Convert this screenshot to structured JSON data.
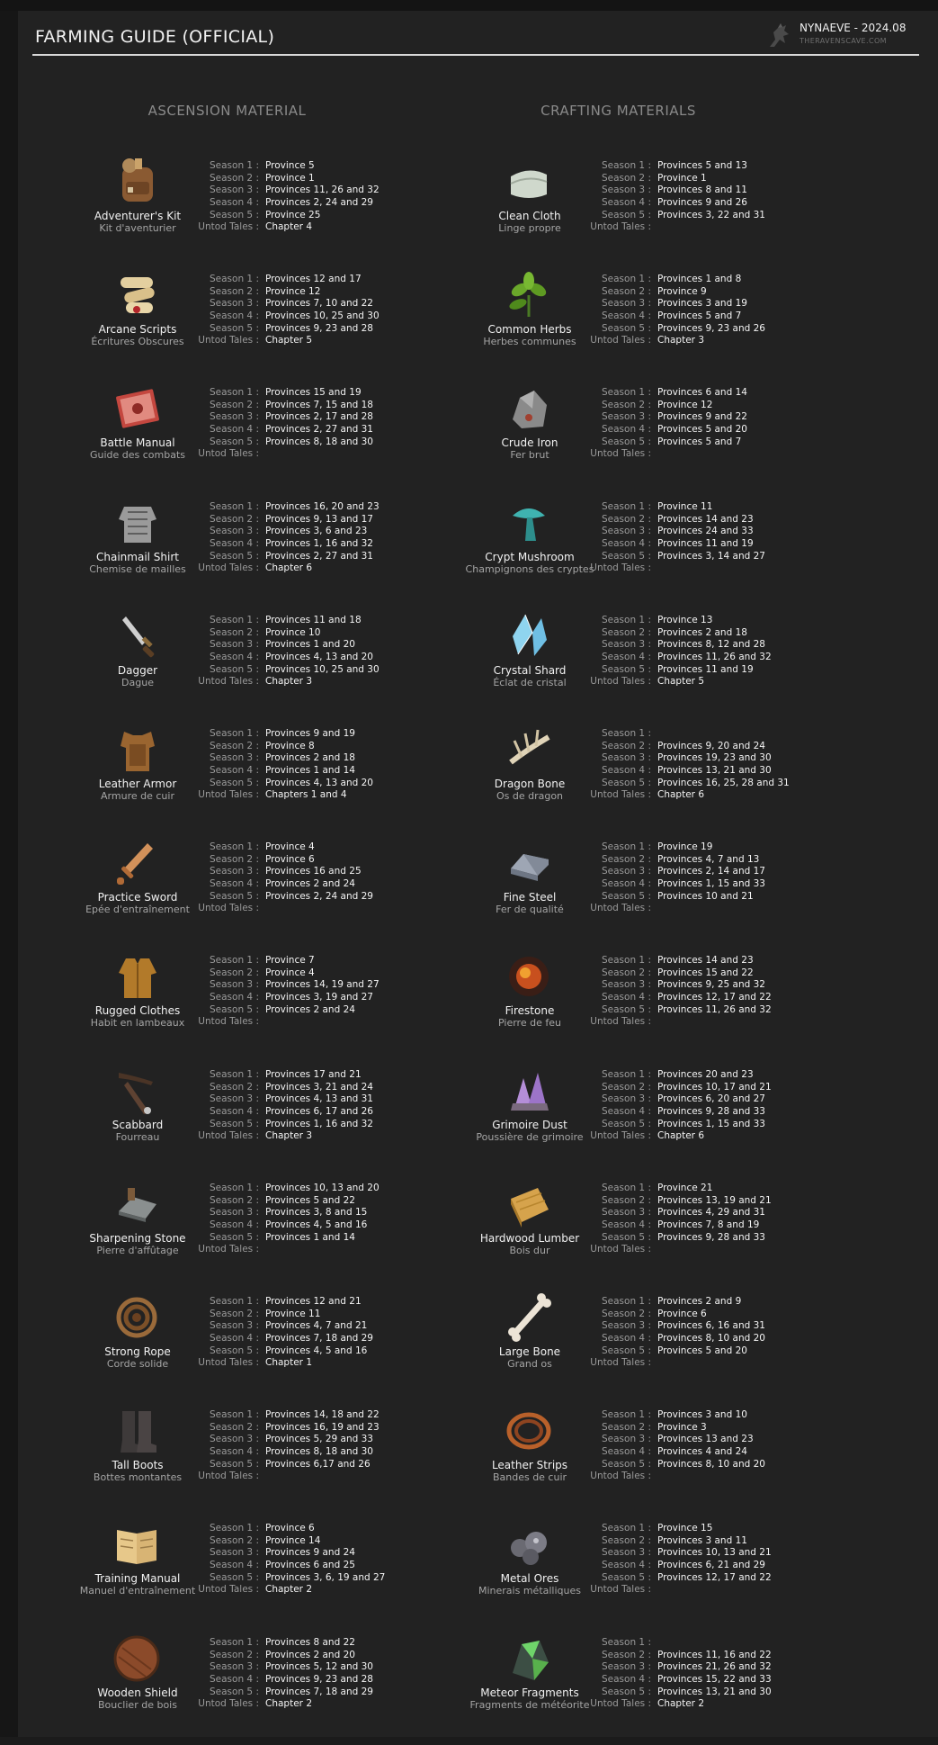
{
  "header": {
    "title": "FARMING GUIDE (OFFICIAL)",
    "author": "NYNAEVE - 2024.08",
    "site": "THERAVENSCAVE.COM"
  },
  "columns": {
    "left_title": "ASCENSION MATERIAL",
    "right_title": "CRAFTING MATERIALS"
  },
  "row_labels": [
    "Season 1 :",
    "Season 2 :",
    "Season 3 :",
    "Season 4 :",
    "Season 5 :",
    "Untod Tales :"
  ],
  "ascension": [
    {
      "icon": "backpack-icon",
      "name": "Adventurer's Kit",
      "fr": "Kit d'aventurier",
      "values": [
        "Province 5",
        "Province 1",
        "Provinces 11, 26 and 32",
        "Provinces 2, 24 and 29",
        "Province 25",
        "Chapter 4"
      ]
    },
    {
      "icon": "scroll-icon",
      "name": "Arcane Scripts",
      "fr": "Écritures Obscures",
      "values": [
        "Provinces 12 and 17",
        "Province 12",
        "Provinces 7, 10 and 22",
        "Provinces 10, 25 and 30",
        "Provinces 9, 23 and 28",
        "Chapter 5"
      ]
    },
    {
      "icon": "book-icon",
      "name": "Battle Manual",
      "fr": "Guide des combats",
      "values": [
        "Provinces 15 and 19",
        "Provinces 7, 15 and 18",
        "Provinces 2, 17 and 28",
        "Provinces 2, 27 and 31",
        "Provinces 8, 18 and 30",
        ""
      ]
    },
    {
      "icon": "chainmail-icon",
      "name": "Chainmail Shirt",
      "fr": "Chemise de mailles",
      "values": [
        "Provinces 16, 20 and 23",
        "Provinces 9, 13 and 17",
        "Provinces 3, 6 and 23",
        "Provinces 1, 16 and 32",
        "Provinces 2, 27 and 31",
        "Chapter 6"
      ]
    },
    {
      "icon": "dagger-icon",
      "name": "Dagger",
      "fr": "Dague",
      "values": [
        "Provinces 11 and 18",
        "Province 10",
        "Provinces 1 and 20",
        "Provinces 4, 13 and 20",
        "Provinces 10, 25 and 30",
        "Chapter 3"
      ]
    },
    {
      "icon": "leather-armor-icon",
      "name": "Leather Armor",
      "fr": "Armure de cuir",
      "values": [
        "Provinces 9 and 19",
        "Province 8",
        "Provinces 2 and 18",
        "Provinces 1 and 14",
        "Provinces 4, 13 and 20",
        "Chapters 1 and 4"
      ]
    },
    {
      "icon": "wooden-sword-icon",
      "name": "Practice Sword",
      "fr": "Epée d'entraînement",
      "values": [
        "Province 4",
        "Province 6",
        "Provinces 16 and 25",
        "Provinces 2 and 24",
        "Provinces 2, 24 and 29",
        ""
      ]
    },
    {
      "icon": "clothes-icon",
      "name": "Rugged Clothes",
      "fr": "Habit en lambeaux",
      "values": [
        "Province 7",
        "Province 4",
        "Provinces 14, 19 and 27",
        "Provinces 3, 19 and 27",
        "Provinces 2 and 24",
        ""
      ]
    },
    {
      "icon": "scabbard-icon",
      "name": "Scabbard",
      "fr": "Fourreau",
      "values": [
        "Provinces 17 and 21",
        "Provinces 3, 21 and 24",
        "Provinces 4, 13 and 31",
        "Provinces 6, 17 and 26",
        "Provinces 1, 16 and 32",
        "Chapter 3"
      ]
    },
    {
      "icon": "whetstone-icon",
      "name": "Sharpening Stone",
      "fr": "Pierre d'affûtage",
      "values": [
        "Provinces 10, 13 and 20",
        "Provinces 5 and 22",
        "Provinces 3, 8 and 15",
        "Provinces 4, 5 and 16",
        "Provinces 1 and 14",
        ""
      ]
    },
    {
      "icon": "rope-icon",
      "name": "Strong Rope",
      "fr": "Corde solide",
      "values": [
        "Provinces 12 and 21",
        "Province 11",
        "Provinces 4, 7 and 21",
        "Provinces 7, 18 and 29",
        "Provinces 4, 5 and 16",
        "Chapter 1"
      ]
    },
    {
      "icon": "boots-icon",
      "name": "Tall Boots",
      "fr": "Bottes montantes",
      "values": [
        "Provinces 14, 18 and 22",
        "Provinces 16, 19 and 23",
        "Provinces 5, 29 and 33",
        "Provinces 8, 18 and 30",
        "Provinces 6,17 and 26",
        ""
      ]
    },
    {
      "icon": "open-book-icon",
      "name": "Training Manual",
      "fr": "Manuel d'entraînement",
      "values": [
        "Province 6",
        "Province 14",
        "Provinces 9 and 24",
        "Provinces 6 and 25",
        "Provinces 3, 6, 19 and 27",
        "Chapter 2"
      ]
    },
    {
      "icon": "shield-icon",
      "name": "Wooden Shield",
      "fr": "Bouclier de bois",
      "values": [
        "Provinces 8 and 22",
        "Provinces 2 and 20",
        "Provinces 5, 12 and 30",
        "Provinces 9, 23 and 28",
        "Provinces 7, 18 and 29",
        "Chapter 2"
      ]
    }
  ],
  "crafting": [
    {
      "icon": "cloth-icon",
      "name": "Clean Cloth",
      "fr": "Linge propre",
      "values": [
        "Provinces 5 and 13",
        "Province 1",
        "Provinces 8 and 11",
        "Provinces 9 and 26",
        "Provinces 3, 22 and 31",
        ""
      ]
    },
    {
      "icon": "herbs-icon",
      "name": "Common Herbs",
      "fr": "Herbes communes",
      "values": [
        "Provinces 1 and 8",
        "Province 9",
        "Provinces 3 and 19",
        "Provinces 5 and 7",
        "Provinces 9, 23 and 26",
        "Chapter 3"
      ]
    },
    {
      "icon": "iron-ore-icon",
      "name": "Crude Iron",
      "fr": "Fer brut",
      "values": [
        "Provinces 6 and 14",
        "Province 12",
        "Provinces 9 and 22",
        "Provinces 5 and 20",
        "Provinces 5 and 7",
        ""
      ]
    },
    {
      "icon": "mushroom-icon",
      "name": "Crypt Mushroom",
      "fr": "Champignons des cryptes",
      "values": [
        "Province 11",
        "Provinces 14 and 23",
        "Provinces 24 and 33",
        "Provinces 11 and 19",
        "Provinces 3, 14 and 27",
        ""
      ]
    },
    {
      "icon": "crystal-icon",
      "name": "Crystal Shard",
      "fr": "Éclat de cristal",
      "values": [
        "Province 13",
        "Provinces 2 and 18",
        "Provinces 8, 12 and 28",
        "Provinces 11, 26 and 32",
        "Provinces 11 and 19",
        "Chapter 5"
      ]
    },
    {
      "icon": "dragon-bone-icon",
      "name": "Dragon Bone",
      "fr": "Os de dragon",
      "values": [
        "",
        "Provinces 9, 20 and 24",
        "Provinces 19, 23 and 30",
        "Provinces 13, 21 and 30",
        "Provinces 16, 25, 28 and 31",
        "Chapter 6"
      ]
    },
    {
      "icon": "steel-ingot-icon",
      "name": "Fine Steel",
      "fr": "Fer de qualité",
      "values": [
        "Province 19",
        "Provinces 4, 7 and 13",
        "Provinces 2, 14 and 17",
        "Provinces 1, 15 and 33",
        "Provinces 10 and 21",
        ""
      ]
    },
    {
      "icon": "firestone-icon",
      "name": "Firestone",
      "fr": "Pierre de feu",
      "values": [
        "Provinces 14 and 23",
        "Provinces 15 and 22",
        "Provinces 9, 25 and 32",
        "Provinces 12, 17 and 22",
        "Provinces 11, 26 and 32",
        ""
      ]
    },
    {
      "icon": "amethyst-icon",
      "name": "Grimoire Dust",
      "fr": "Poussière de grimoire",
      "values": [
        "Provinces 20 and 23",
        "Provinces 10, 17 and 21",
        "Provinces 6, 20 and 27",
        "Provinces 9, 28 and 33",
        "Provinces 1, 15 and 33",
        "Chapter 6"
      ]
    },
    {
      "icon": "lumber-icon",
      "name": "Hardwood Lumber",
      "fr": "Bois dur",
      "values": [
        "Province 21",
        "Provinces 13, 19 and 21",
        "Provinces 4, 29 and 31",
        "Provinces 7, 8 and 19",
        "Provinces 9, 28 and 33",
        ""
      ]
    },
    {
      "icon": "bone-icon",
      "name": "Large Bone",
      "fr": "Grand os",
      "values": [
        "Provinces 2 and 9",
        "Province 6",
        "Provinces 6, 16 and 31",
        "Provinces 8, 10 and 20",
        "Provinces 5 and 20",
        ""
      ]
    },
    {
      "icon": "leather-strips-icon",
      "name": "Leather Strips",
      "fr": "Bandes de cuir",
      "values": [
        "Provinces 3 and 10",
        "Province 3",
        "Provinces 13 and 23",
        "Provinces 4 and 24",
        "Provinces 8, 10 and 20",
        ""
      ]
    },
    {
      "icon": "ore-icon",
      "name": "Metal Ores",
      "fr": "Minerais métalliques",
      "values": [
        "Province 15",
        "Provinces 3 and 11",
        "Provinces 10, 13 and 21",
        "Provinces 6, 21 and 29",
        "Provinces 12, 17 and 22",
        ""
      ]
    },
    {
      "icon": "meteor-icon",
      "name": "Meteor Fragments",
      "fr": "Fragments de météorite",
      "values": [
        "",
        "Provinces 11, 16 and 22",
        "Provinces 21, 26 and 32",
        "Provinces 15, 22 and 33",
        "Provinces 13, 21 and 30",
        "Chapter 2"
      ]
    }
  ]
}
